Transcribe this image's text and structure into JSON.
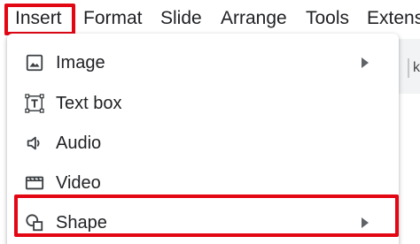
{
  "menubar": {
    "items": [
      {
        "label": "Insert"
      },
      {
        "label": "Format"
      },
      {
        "label": "Slide"
      },
      {
        "label": "Arrange"
      },
      {
        "label": "Tools"
      },
      {
        "label": "Extens"
      }
    ]
  },
  "insert_menu": {
    "items": [
      {
        "label": "Image",
        "icon": "image-icon",
        "has_submenu": true
      },
      {
        "label": "Text box",
        "icon": "text-box-icon",
        "has_submenu": false
      },
      {
        "label": "Audio",
        "icon": "audio-icon",
        "has_submenu": false
      },
      {
        "label": "Video",
        "icon": "video-icon",
        "has_submenu": false
      },
      {
        "label": "Shape",
        "icon": "shape-icon",
        "has_submenu": true
      }
    ]
  },
  "background": {
    "glyph": "k"
  },
  "colors": {
    "highlight": "#e30613",
    "text": "#202124",
    "icon": "#3c4043"
  }
}
